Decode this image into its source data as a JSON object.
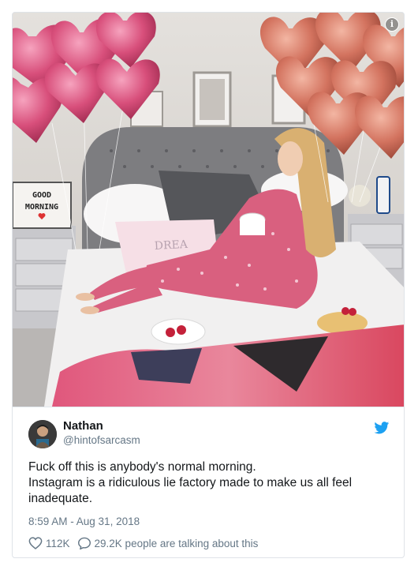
{
  "photo": {
    "alt_icon": "info-icon",
    "lightbox_text": "GOOD MORNING",
    "pillow_text": "DREA"
  },
  "tweet": {
    "display_name": "Nathan",
    "handle": "@hintofsarcasm",
    "text_lines": [
      "Fuck off this is anybody's normal morning.",
      "Instagram is a ridiculous lie factory made to make us all feel",
      "inadequate."
    ],
    "timestamp": "8:59 AM - Aug 31, 2018",
    "likes": "112K",
    "replies_text": "29.2K people are talking about this",
    "colors": {
      "twitter_blue": "#1da1f2",
      "text": "#14171a",
      "muted": "#657786"
    },
    "icons": {
      "brand": "twitter-bird-icon",
      "like": "heart-icon",
      "reply": "speech-bubble-icon"
    }
  }
}
